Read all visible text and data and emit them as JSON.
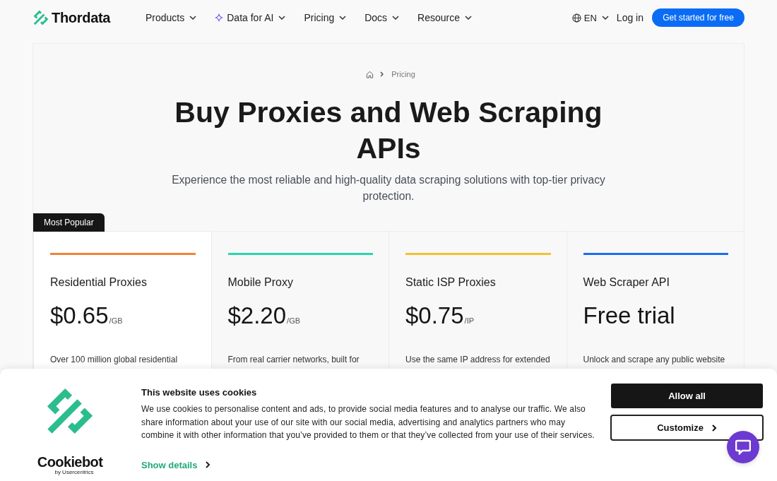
{
  "navbar": {
    "brand": "Thordata",
    "menu": [
      {
        "label": "Products",
        "kind": "plain"
      },
      {
        "label": "Data for AI",
        "kind": "highlight"
      },
      {
        "label": "Pricing",
        "kind": "plain"
      },
      {
        "label": "Docs",
        "kind": "plain"
      },
      {
        "label": "Resource",
        "kind": "plain"
      }
    ],
    "language": "EN",
    "login": "Log in",
    "cta": "Get started for free"
  },
  "hero": {
    "breadcrumb": [
      "Pricing"
    ],
    "title": "Buy Proxies and Web Scraping APIs",
    "subtitle": "Experience the most reliable and high-quality data scraping solutions with top-tier privacy protection."
  },
  "pricing": {
    "popular_badge": "Most Popular",
    "plans": [
      {
        "name": "Residential Proxies",
        "price": "$0.65",
        "unit": "/GB",
        "description": "Over 100 million global residential",
        "color": "#f0843a",
        "popular": true
      },
      {
        "name": "Mobile Proxy",
        "price": "$2.20",
        "unit": "/GB",
        "description": "From real carrier networks, built for",
        "color": "#2dd4ac",
        "popular": false
      },
      {
        "name": "Static ISP Proxies",
        "price": "$0.75",
        "unit": "/IP",
        "description": "Use the same IP address for extended",
        "color": "#f2c230",
        "popular": false
      },
      {
        "name": "Web Scraper API",
        "price": "Free trial",
        "description": "Unlock and scrape any public website",
        "color": "#1a6ef0",
        "popular": false
      }
    ]
  },
  "cookie_banner": {
    "provider": "Cookiebot",
    "provider_tagline": "by Usercentrics",
    "title": "This website uses cookies",
    "body": "We use cookies to personalise content and ads, to provide social media features and to analyse our traffic. We also share information about your use of our site with our social media, advertising and analytics partners who may combine it with other information that you’ve provided to them or that they’ve collected from your use of their services.",
    "details_link": "Show details",
    "buttons": [
      {
        "label": "Allow all",
        "kind": "primary"
      },
      {
        "label": "Customize",
        "kind": "outline"
      }
    ]
  }
}
